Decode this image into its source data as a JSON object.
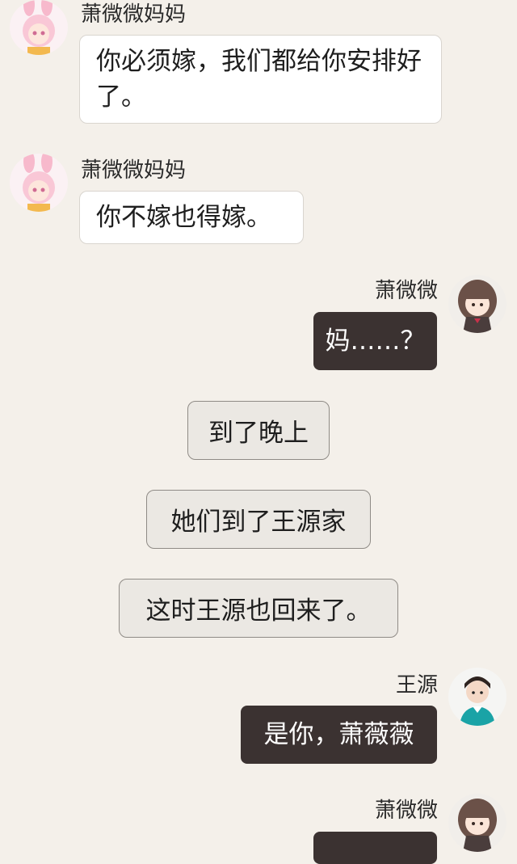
{
  "messages": [
    {
      "sender": "萧微微妈妈",
      "text": "你必须嫁，我们都给你安排好了。",
      "side": "left",
      "avatar": "bunny-girl-avatar-icon"
    },
    {
      "sender": "萧微微妈妈",
      "text": "你不嫁也得嫁。",
      "side": "left",
      "avatar": "bunny-girl-avatar-icon"
    },
    {
      "sender": "萧微微",
      "text": "妈……？",
      "side": "right",
      "avatar": "brown-hair-girl-avatar-icon"
    },
    {
      "type": "narration",
      "text": "到了晚上"
    },
    {
      "type": "narration",
      "text": "她们到了王源家"
    },
    {
      "type": "narration",
      "text": "这时王源也回来了。"
    },
    {
      "sender": "王源",
      "text": "是你，萧薇薇",
      "side": "right",
      "avatar": "boy-teal-shirt-avatar-icon"
    },
    {
      "sender": "萧微微",
      "text": "",
      "side": "right",
      "avatar": "brown-hair-girl-avatar-icon"
    }
  ],
  "colors": {
    "background": "#f4f0ea",
    "left_bubble": "#ffffff",
    "right_bubble": "#3b3231",
    "narration_bubble": "#ebe8e3"
  }
}
